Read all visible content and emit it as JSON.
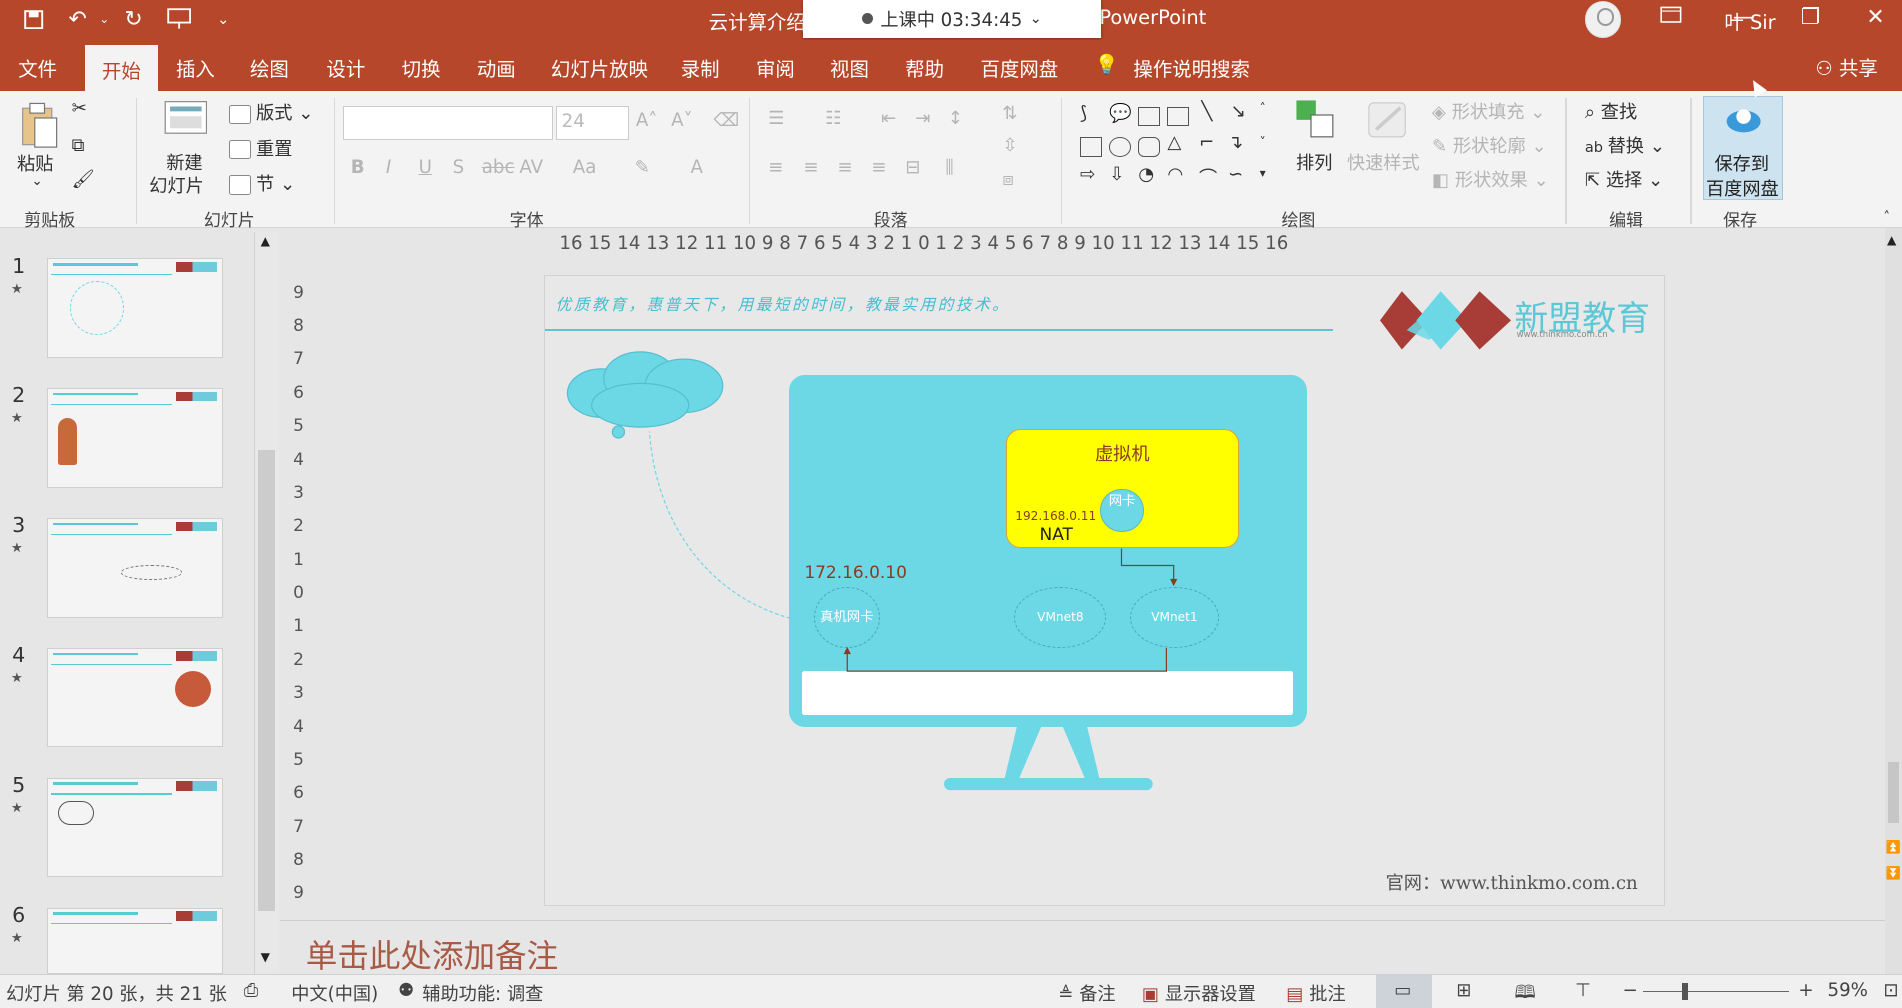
{
  "titlebar": {
    "doc_title_left": "云计算介绍。",
    "doc_title_right": "PowerPoint",
    "timer_text": "上课中 03:34:45",
    "user_name": "叶 Sir"
  },
  "menu": {
    "tabs": [
      "文件",
      "开始",
      "插入",
      "绘图",
      "设计",
      "切换",
      "动画",
      "幻灯片放映",
      "录制",
      "审阅",
      "视图",
      "帮助",
      "百度网盘",
      "操作说明搜索"
    ],
    "active_tab": "开始",
    "share": "共享"
  },
  "ribbon": {
    "clipboard": {
      "paste": "粘贴",
      "group": "剪贴板"
    },
    "slides": {
      "new_slide_1": "新建",
      "new_slide_2": "幻灯片",
      "layout": "版式",
      "reset": "重置",
      "section": "节",
      "group": "幻灯片"
    },
    "font": {
      "size": "24",
      "group": "字体"
    },
    "paragraph": {
      "group": "段落"
    },
    "drawing": {
      "arrange": "排列",
      "quick_styles": "快速样式",
      "shape_fill": "形状填充",
      "shape_outline": "形状轮廓",
      "shape_effects": "形状效果",
      "group": "绘图"
    },
    "editing": {
      "find": "查找",
      "replace": "替换",
      "select": "选择",
      "group": "编辑"
    },
    "save": {
      "line1": "保存到",
      "line2": "百度网盘",
      "group": "保存"
    }
  },
  "thumbnails": [
    {
      "num": "1",
      "star": "★"
    },
    {
      "num": "2",
      "star": "★"
    },
    {
      "num": "3",
      "star": "★"
    },
    {
      "num": "4",
      "star": "★"
    },
    {
      "num": "5",
      "star": "★"
    },
    {
      "num": "6",
      "star": "★"
    }
  ],
  "ruler": {
    "horizontal": "16 15 14 13 12 11 10 9 8 7 6 5 4 3 2 1 0 1 2 3 4 5 6 7 8 9 10 11 12 13 14 15 16",
    "vertical": [
      "9",
      "8",
      "7",
      "6",
      "5",
      "4",
      "3",
      "2",
      "1",
      "0",
      "1",
      "2",
      "3",
      "4",
      "5",
      "6",
      "7",
      "8",
      "9"
    ]
  },
  "slide": {
    "slogan": "优质教育，惠普天下，用最短的时间，教最实用的技术。",
    "brand": "新盟教育",
    "brand_sub": "www.thinkmo.com.cn",
    "website": "官网：www.thinkmo.com.cn",
    "vm_title": "虚拟机",
    "vm_ip": "192.168.0.11",
    "vm_nat": "NAT",
    "vm_nic": "网卡",
    "host_ip": "172.16.0.10",
    "host_nic": "真机网卡",
    "vmnet8": "VMnet8",
    "vmnet1": "VMnet1"
  },
  "notes_placeholder": "单击此处添加备注",
  "status": {
    "slide_info": "幻灯片 第 20 张，共 21 张",
    "language": "中文(中国)",
    "accessibility": "辅助功能: 调查",
    "notes": "备注",
    "display_settings": "显示器设置",
    "comments": "批注",
    "zoom": "59%"
  },
  "colors": {
    "accent": "#b7472a",
    "teal": "#6cd8e6",
    "vm_yellow": "#ffff00"
  }
}
